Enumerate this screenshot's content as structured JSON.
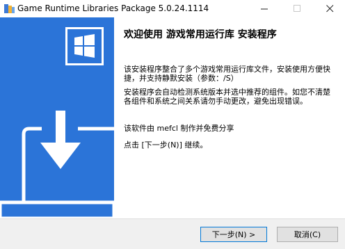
{
  "window": {
    "title": "Game Runtime Libraries Package 5.0.24.1114",
    "controls": {
      "minimize_icon": "minimize-icon",
      "maximize_icon": "maximize-icon",
      "close_icon": "close-icon"
    }
  },
  "sidebar": {
    "background": "#2b74d8",
    "logo_icon": "windows-logo-icon",
    "illustration_icon": "download-to-laptop-icon"
  },
  "content": {
    "heading": "欢迎使用 游戏常用运行库 安装程序",
    "paragraphs": [
      "该安装程序整合了多个游戏常用运行库文件，安装使用方便快捷，并支持静默安装（参数：/S）",
      "安装程序会自动检测系统版本并选中推荐的组件。如您不清楚各组件和系统之间关系请勿手动更改，避免出现错误。",
      "该软件由 mefcl 制作并免费分享",
      "点击 [下一步(N)] 继续。"
    ]
  },
  "footer": {
    "next_label": "下一步(N) >",
    "cancel_label": "取消(C)"
  }
}
